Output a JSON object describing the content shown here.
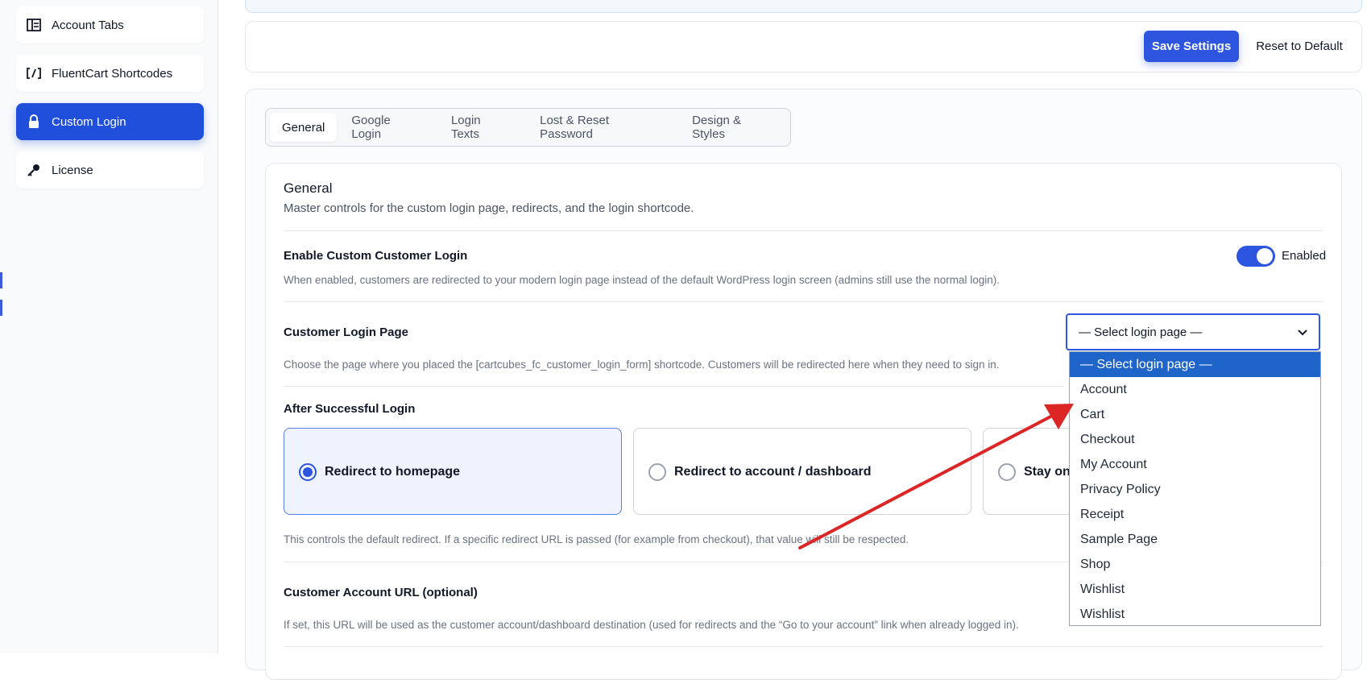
{
  "sidebar": {
    "items": [
      {
        "label": "Account Tabs",
        "icon": "layout-icon"
      },
      {
        "label": "FluentCart Shortcodes",
        "icon": "shortcode-icon"
      },
      {
        "label": "Custom Login",
        "icon": "lock-icon",
        "active": true
      },
      {
        "label": "License",
        "icon": "key-icon"
      }
    ]
  },
  "toolbar": {
    "save_label": "Save Settings",
    "reset_label": "Reset to Default"
  },
  "tabs": [
    {
      "label": "General",
      "active": true
    },
    {
      "label": "Google Login"
    },
    {
      "label": "Login Texts"
    },
    {
      "label": "Lost & Reset Password"
    },
    {
      "label": "Design & Styles"
    }
  ],
  "section": {
    "title": "General",
    "subtitle": "Master controls for the custom login page, redirects, and the login shortcode."
  },
  "enable_login": {
    "label": "Enable Custom Customer Login",
    "status": "Enabled",
    "enabled": true,
    "help": "When enabled, customers are redirected to your modern login page instead of the default WordPress login screen (admins still use the normal login)."
  },
  "login_page": {
    "label": "Customer Login Page",
    "selected": "— Select login page —",
    "help": "Choose the page where you placed the [cartcubes_fc_customer_login_form] shortcode. Customers will be redirected here when they need to sign in.",
    "options": [
      "— Select login page —",
      "Account",
      "Cart",
      "Checkout",
      "My Account",
      "Privacy Policy",
      "Receipt",
      "Sample Page",
      "Shop",
      "Wishlist",
      "Wishlist"
    ]
  },
  "after_login": {
    "label": "After Successful Login",
    "options": [
      {
        "label": "Redirect to homepage",
        "selected": true
      },
      {
        "label": "Redirect to account / dashboard",
        "selected": false
      },
      {
        "label": "Stay on",
        "selected": false
      }
    ],
    "help": "This controls the default redirect. If a specific redirect URL is passed (for example from checkout), that value will still be respected."
  },
  "account_url": {
    "label": "Customer Account URL (optional)",
    "help": "If set, this URL will be used as the customer account/dashboard destination (used for redirects and the “Go to your account” link when already logged in)."
  },
  "colors": {
    "accent": "#2d55e0",
    "annotation_arrow": "#dc2626",
    "dropdown_highlight": "#1f64c8"
  }
}
